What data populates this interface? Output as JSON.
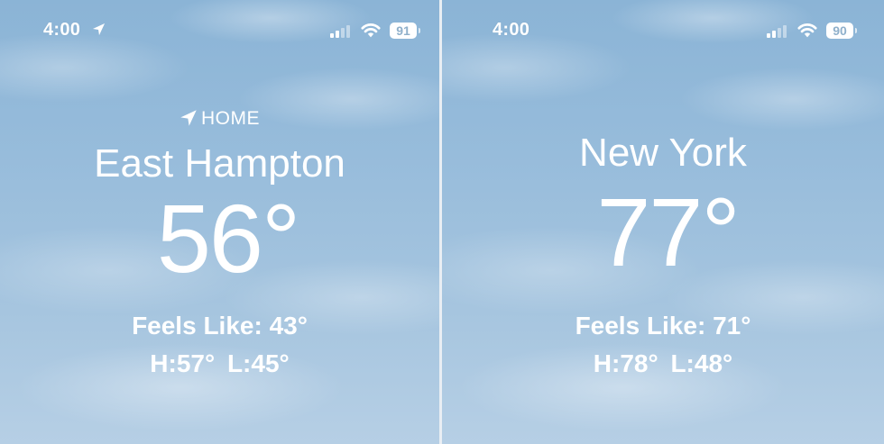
{
  "left": {
    "status": {
      "time": "4:00",
      "battery": "91"
    },
    "location_tag": "HOME",
    "city": "East Hampton",
    "temperature": "56°",
    "feels_like": "Feels Like: 43°",
    "high_low": "H:57°  L:45°"
  },
  "right": {
    "status": {
      "time": "4:00",
      "battery": "90"
    },
    "city": "New York",
    "temperature": "77°",
    "feels_like": "Feels Like: 71°",
    "high_low": "H:78°  L:48°"
  },
  "icons": {
    "location": "location-arrow-icon",
    "signal": "cellular-signal-icon",
    "wifi": "wifi-icon",
    "battery": "battery-icon"
  },
  "colors": {
    "sky_top": "#8bb4d6",
    "sky_bottom": "#b6cfe5",
    "text": "#ffffff"
  }
}
